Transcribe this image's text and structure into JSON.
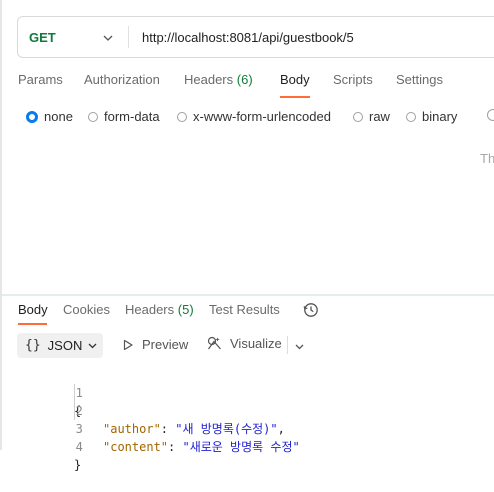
{
  "request": {
    "method": "GET",
    "url": "http://localhost:8081/api/guestbook/5",
    "tabs": [
      {
        "label": "Params"
      },
      {
        "label": "Authorization"
      },
      {
        "label": "Headers",
        "count": "(6)"
      },
      {
        "label": "Body"
      },
      {
        "label": "Scripts"
      },
      {
        "label": "Settings"
      }
    ],
    "active_tab": "Body",
    "body_types": [
      "none",
      "form-data",
      "x-www-form-urlencoded",
      "raw",
      "binary"
    ],
    "selected_body_type": "none",
    "hint_text": "Th"
  },
  "response": {
    "tabs": [
      {
        "label": "Body"
      },
      {
        "label": "Cookies"
      },
      {
        "label": "Headers",
        "count": "(5)"
      },
      {
        "label": "Test Results"
      }
    ],
    "active_tab": "Body",
    "format": "JSON",
    "format_braces": "{}",
    "preview_label": "Preview",
    "visualize_label": "Visualize",
    "lines": [
      {
        "number": "1",
        "text": "{"
      },
      {
        "number": "2",
        "key": "\"author\"",
        "value": "\"새 방명록(수정)\"",
        "suffix": ","
      },
      {
        "number": "3",
        "key": "\"content\"",
        "value": "\"새로운 방명록 수정\"",
        "suffix": ""
      },
      {
        "number": "4",
        "text": "}"
      }
    ]
  },
  "colors": {
    "accent": "#ff6c37",
    "method": "#0f7b3b",
    "radio_selected": "#097bed",
    "json_key": "#a26500",
    "json_string": "#1d1dd6"
  },
  "icons": [
    "chevron-down-icon",
    "history-icon",
    "play-icon",
    "visualize-icon"
  ]
}
